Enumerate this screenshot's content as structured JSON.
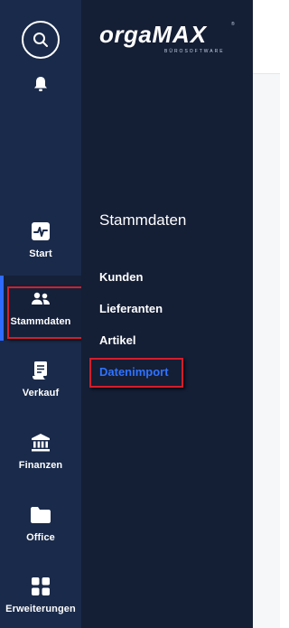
{
  "brand": {
    "name_part1": "orga",
    "name_part2": "MAX",
    "tagline": "BÜROSOFTWARE",
    "trademark": "®"
  },
  "rail": {
    "items": [
      {
        "label": "Start",
        "icon": "activity-icon"
      },
      {
        "label": "Stammdaten",
        "icon": "people-icon",
        "active": true
      },
      {
        "label": "Verkauf",
        "icon": "receipt-icon"
      },
      {
        "label": "Finanzen",
        "icon": "bank-icon"
      },
      {
        "label": "Office",
        "icon": "folder-icon"
      },
      {
        "label": "Erweiterungen",
        "icon": "apps-icon"
      }
    ]
  },
  "panel": {
    "title": "Stammdaten",
    "items": [
      {
        "label": "Kunden"
      },
      {
        "label": "Lieferanten"
      },
      {
        "label": "Artikel"
      },
      {
        "label": "Datenimport",
        "active": true
      }
    ]
  },
  "colors": {
    "rail_bg": "#1a2a4a",
    "panel_bg": "#141e35",
    "accent": "#2f6bff",
    "highlight": "#d31e2b"
  }
}
